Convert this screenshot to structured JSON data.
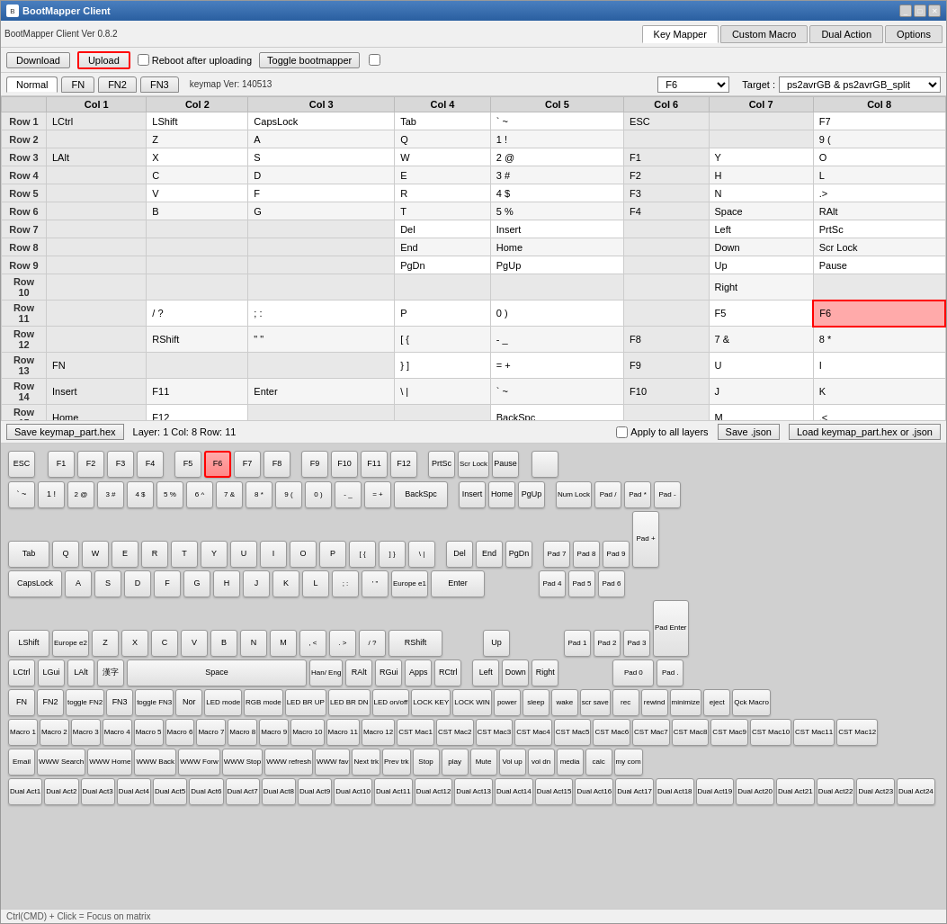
{
  "window": {
    "title": "BootMapper Client",
    "version": "BootMapper Client Ver 0.8.2"
  },
  "tabs_top": [
    {
      "label": "Key Mapper",
      "active": true
    },
    {
      "label": "Custom Macro",
      "active": false
    },
    {
      "label": "Dual Action",
      "active": false
    },
    {
      "label": "Options",
      "active": false
    }
  ],
  "toolbar": {
    "download": "Download",
    "upload": "Upload",
    "reboot_label": "Reboot after uploading",
    "toggle_label": "Toggle bootmapper"
  },
  "layers": [
    {
      "label": "Normal",
      "active": true
    },
    {
      "label": "FN",
      "active": false
    },
    {
      "label": "FN2",
      "active": false
    },
    {
      "label": "FN3",
      "active": false
    }
  ],
  "keymap_ver": "keymap Ver: 140513",
  "f6_value": "F6",
  "target": "ps2avrGB & ps2avrGB_split",
  "columns": [
    "Col 1",
    "Col 2",
    "Col 3",
    "Col 4",
    "Col 5",
    "Col 6",
    "Col 7",
    "Col 8"
  ],
  "rows": [
    {
      "label": "Row 1",
      "cols": [
        "LCtrl",
        "LShift",
        "CapsLock",
        "Tab",
        "` ~",
        "ESC",
        "",
        "F7"
      ]
    },
    {
      "label": "Row 2",
      "cols": [
        "",
        "Z",
        "A",
        "Q",
        "1 !",
        "",
        "",
        "9 ("
      ]
    },
    {
      "label": "Row 3",
      "cols": [
        "LAlt",
        "X",
        "S",
        "W",
        "2 @",
        "F1",
        "Y",
        "O"
      ]
    },
    {
      "label": "Row 4",
      "cols": [
        "",
        "C",
        "D",
        "E",
        "3 #",
        "F2",
        "H",
        "L"
      ]
    },
    {
      "label": "Row 5",
      "cols": [
        "",
        "V",
        "F",
        "R",
        "4 $",
        "F3",
        "N",
        ".>"
      ]
    },
    {
      "label": "Row 6",
      "cols": [
        "",
        "B",
        "G",
        "T",
        "5 %",
        "F4",
        "Space",
        "RAlt"
      ]
    },
    {
      "label": "Row 7",
      "cols": [
        "",
        "",
        "",
        "Del",
        "Insert",
        "",
        "Left",
        "PrtSc"
      ]
    },
    {
      "label": "Row 8",
      "cols": [
        "",
        "",
        "",
        "End",
        "Home",
        "",
        "Down",
        "Scr Lock"
      ]
    },
    {
      "label": "Row 9",
      "cols": [
        "",
        "",
        "",
        "PgDn",
        "PgUp",
        "",
        "Up",
        "Pause"
      ]
    },
    {
      "label": "Row 10",
      "cols": [
        "",
        "",
        "",
        "",
        "",
        "",
        "Right",
        ""
      ]
    },
    {
      "label": "Row 11",
      "cols": [
        "",
        "/ ?",
        ";  :",
        "P",
        "0 )",
        "",
        "F5",
        "F6"
      ]
    },
    {
      "label": "Row 12",
      "cols": [
        "",
        "RShift",
        "\" \"",
        "[ {",
        "- _",
        "F8",
        "7 &",
        "8 *"
      ]
    },
    {
      "label": "Row 13",
      "cols": [
        "FN",
        "",
        ""
      ],
      "extra": [
        "} ]",
        "= +",
        "F9",
        "U",
        "I"
      ]
    },
    {
      "label": "Row 14",
      "cols": [
        "Insert",
        "F11",
        "Enter",
        "| \\",
        "` ~",
        "F10",
        "J",
        "K"
      ]
    },
    {
      "label": "Row 15",
      "cols": [
        "Home",
        "F12",
        "",
        "",
        "BackSpc",
        "",
        "M",
        ",<"
      ]
    }
  ],
  "status": {
    "save_keymap": "Save keymap_part.hex",
    "layer_info": "Layer: 1 Col: 8 Row: 11",
    "apply_all": "Apply to all layers",
    "save_json": "Save .json",
    "load_keymap": "Load keymap_part.hex or .json"
  },
  "keyboard": {
    "row1": [
      "ESC",
      "F1",
      "F2",
      "F3",
      "F4",
      "F5",
      "F6",
      "F7",
      "F8",
      "F9",
      "F10",
      "F11",
      "F12",
      "PrtSc",
      "Scr Lock",
      "Pause",
      ""
    ],
    "row2": [
      "` ~",
      "1 !",
      "2 @",
      "3 #",
      "4 $",
      "5 %",
      "6 ^",
      "7 &",
      "8 *",
      "9 (",
      "0 )",
      "- _",
      "= +",
      "BackSpc",
      "Insert",
      "Home",
      "PgUp",
      "Num Lock",
      "Pad /",
      "Pad *",
      "Pad -"
    ],
    "row3": [
      "Tab",
      "Q",
      "W",
      "E",
      "R",
      "T",
      "Y",
      "U",
      "I",
      "O",
      "P",
      "[ {",
      "} ]",
      "| \\",
      "Del",
      "End",
      "PgDn",
      "Pad 7",
      "Pad 8",
      "Pad 9",
      "Pad +"
    ],
    "row4": [
      "CapsLock",
      "A",
      "S",
      "D",
      "F",
      "G",
      "H",
      "J",
      "K",
      "L",
      "; :",
      "' \"",
      "Europe e1",
      "Enter",
      "Pad 4",
      "Pad 5",
      "Pad 6"
    ],
    "row5": [
      "LShift",
      "Europe e2",
      "Z",
      "X",
      "C",
      "V",
      "B",
      "N",
      "M",
      ", <",
      ". >",
      "/ ?",
      "RShift",
      "Up",
      "Pad 1",
      "Pad 2",
      "Pad 3",
      "Pad Enter"
    ],
    "row6": [
      "LCtrl",
      "LGui",
      "LAlt",
      "漢字",
      "Space",
      "Han/ Eng",
      "RAlt",
      "RGui",
      "Apps",
      "RCtrl",
      "Left",
      "Down",
      "Right",
      "Pad 0",
      "Pad ."
    ],
    "row7": [
      "FN",
      "FN2",
      "toggle FN2",
      "FN3",
      "toggle FN3",
      "Nor",
      "LED mode",
      "RGB mode",
      "LED BR UP",
      "LED BR DN",
      "LED on/off",
      "LOCK KEY",
      "LOCK WIN",
      "power",
      "sleep",
      "wake",
      "scr save",
      "rec",
      "rewind",
      "minimize",
      "eject",
      "Qck Macro"
    ],
    "row8": [
      "Macro 1",
      "Macro 2",
      "Macro 3",
      "Macro 4",
      "Macro 5",
      "Macro 6",
      "Macro 7",
      "Macro 8",
      "Macro 9",
      "Macro 10",
      "Macro 11",
      "Macro 12",
      "CST Mac1",
      "CST Mac2",
      "CST Mac3",
      "CST Mac4",
      "CST Mac5",
      "CST Mac6",
      "CST Mac7",
      "CST Mac8",
      "CST Mac9",
      "CST Mac10",
      "CST Mac11",
      "CST Mac12"
    ],
    "row9": [
      "Email",
      "WWW Search",
      "WWW Home",
      "WWW Back",
      "WWW Forw",
      "WWW Stop",
      "WWW refresh",
      "WWW fav",
      "Next trk",
      "Prev trk",
      "Stop",
      "play",
      "Mute",
      "Vol up",
      "vol dn",
      "media",
      "calc",
      "my com"
    ],
    "row10": [
      "Dual Act1",
      "Dual Act2",
      "Dual Act3",
      "Dual Act4",
      "Dual Act5",
      "Dual Act6",
      "Dual Act7",
      "Dual Act8",
      "Dual Act9",
      "Dual Act10",
      "Dual Act11",
      "Dual Act12",
      "Dual Act13",
      "Dual Act14",
      "Dual Act15",
      "Dual Act16",
      "Dual Act17",
      "Dual Act18",
      "Dual Act19",
      "Dual Act20",
      "Dual Act21",
      "Dual Act22",
      "Dual Act23",
      "Dual Act24"
    ]
  },
  "hint": "Ctrl(CMD) + Click = Focus on matrix"
}
